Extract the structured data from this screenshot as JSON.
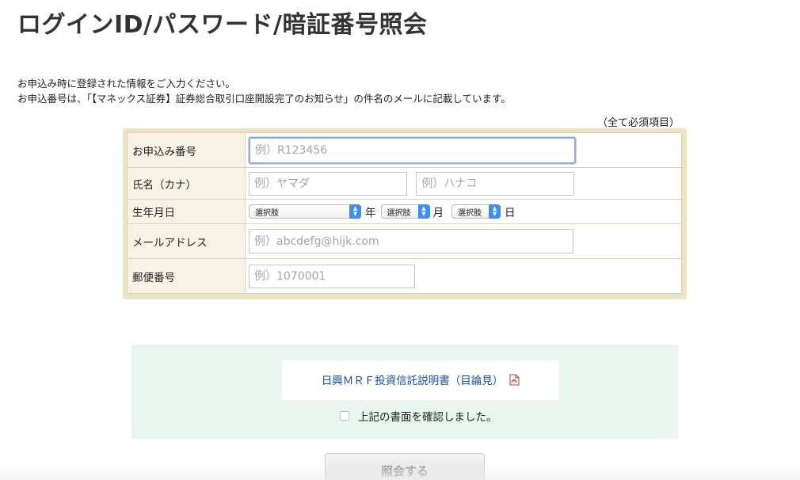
{
  "page": {
    "title": "ログインID/パスワード/暗証番号照会"
  },
  "intro": {
    "line1": "お申込み時に登録された情報をご入力ください。",
    "line2": "お申込番号は、「【マネックス証券】証券総合取引口座開設完了のお知らせ」の件名のメールに記載しています。"
  },
  "required_note": "（全て必須項目）",
  "form": {
    "application_number": {
      "label": "お申込み番号",
      "placeholder": "例）R123456",
      "value": ""
    },
    "name_kana": {
      "label": "氏名（カナ）",
      "last_placeholder": "例）ヤマダ",
      "first_placeholder": "例）ハナコ"
    },
    "birthdate": {
      "label": "生年月日",
      "year_selected": "選択肢",
      "year_unit": "年",
      "month_selected": "選択肢",
      "month_unit": "月",
      "day_selected": "選択肢",
      "day_unit": "日"
    },
    "email": {
      "label": "メールアドレス",
      "placeholder": "例）abcdefg@hijk.com"
    },
    "postal_code": {
      "label": "郵便番号",
      "placeholder": "例）1070001"
    }
  },
  "confirm": {
    "doc_link": "日興ＭＲＦ投資信託説明書（目論見）",
    "doc_icon": "pdf-icon",
    "checkbox_label": "上記の書面を確認しました。",
    "checked": false
  },
  "submit": {
    "label": "照会する"
  },
  "colors": {
    "form_frame": "#efe4c2",
    "label_bg": "#f7f3e6",
    "confirm_bg": "#e9f6ef",
    "link": "#1a4fa3",
    "select_accent": "#3d8ef5",
    "focus_border": "#8eaee0"
  }
}
